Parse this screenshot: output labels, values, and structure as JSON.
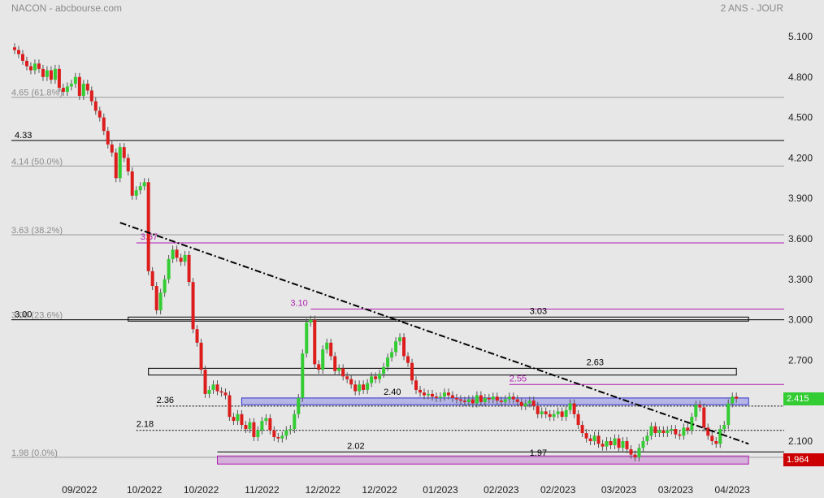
{
  "header": {
    "title": "NACON - abcbourse.com",
    "period": "2 ANS - JOUR"
  },
  "chart_data": {
    "type": "candlestick",
    "ylim": [
      1.93,
      5.16
    ],
    "y_ticks": [
      "5.100",
      "4.800",
      "4.500",
      "4.200",
      "3.900",
      "3.600",
      "3.300",
      "3.000",
      "2.700",
      "2.400",
      "2.100"
    ],
    "x_labels": [
      {
        "label": "09/2022",
        "i": 14
      },
      {
        "label": "10/2022",
        "i": 30
      },
      {
        "label": "10/2022",
        "i": 44
      },
      {
        "label": "11/2022",
        "i": 59
      },
      {
        "label": "12/2022",
        "i": 74
      },
      {
        "label": "12/2022",
        "i": 88
      },
      {
        "label": "01/2023",
        "i": 103
      },
      {
        "label": "02/2023",
        "i": 118
      },
      {
        "label": "02/2023",
        "i": 132
      },
      {
        "label": "03/2023",
        "i": 147
      },
      {
        "label": "03/2023",
        "i": 161
      },
      {
        "label": "04/2023",
        "i": 175
      }
    ],
    "colors": {
      "up": "#33cc33",
      "down": "#dd1c1c",
      "fib": "#9a9a9a",
      "magenta": "#b01eb0",
      "level": "#000000",
      "zone_blue": "#3333cc",
      "zone_mag": "#b01eb0"
    },
    "fib_levels": [
      {
        "value": 4.65,
        "label": "4.65 (61.8%)"
      },
      {
        "value": 4.14,
        "label": "4.14 (50.0%)"
      },
      {
        "value": 3.63,
        "label": "3.63 (38.2%)"
      },
      {
        "value": 3.0,
        "label": "3.00 (23.6%)"
      },
      {
        "value": 1.98,
        "label": "1.98 (0.0%)"
      }
    ],
    "hlines": [
      {
        "value": 4.33,
        "label": "4.33",
        "x_from": 0,
        "label_x": 5
      },
      {
        "value": 3.0,
        "label": "3.00",
        "x_from": 0,
        "label_x": 5
      }
    ],
    "magenta_lines": [
      {
        "value": 3.57,
        "label": "3.57",
        "i_from": 30,
        "label_i": 31
      },
      {
        "value": 3.08,
        "label": "3.10",
        "i_from": 73,
        "label_i": 68
      },
      {
        "value": 2.52,
        "label": "2.55",
        "i_from": 122,
        "label_i": 122
      }
    ],
    "rects": [
      {
        "y1": 3.02,
        "y2": 2.99,
        "i_from": 28,
        "i_to": 181,
        "label": "3.03",
        "label_i": 127,
        "label_val": 3.03,
        "style": "line"
      },
      {
        "y1": 2.64,
        "y2": 2.59,
        "i_from": 33,
        "i_to": 178,
        "label": "2.63",
        "label_i": 141,
        "label_val": 2.65,
        "style": "line"
      },
      {
        "y1": 2.42,
        "y2": 2.37,
        "i_from": 56,
        "i_to": 181,
        "label": "2.40",
        "label_i": 91,
        "label_val": 2.43,
        "style": "blue"
      },
      {
        "y1": 1.99,
        "y2": 1.93,
        "i_from": 50,
        "i_to": 181,
        "label": "1.97",
        "label_i": 127,
        "label_val": 1.98,
        "style": "mag"
      }
    ],
    "dotted_lines": [
      {
        "value": 2.36,
        "label": "2.36",
        "i_from": 35,
        "label_i": 35
      },
      {
        "value": 2.18,
        "label": "2.18",
        "i_from": 30,
        "label_i": 30
      },
      {
        "value": 2.02,
        "label": "2.02",
        "i_from": 50,
        "label_i": 82,
        "dotted": false
      }
    ],
    "trendline": {
      "i1": 26,
      "v1": 3.72,
      "i2": 181,
      "v2": 2.08
    },
    "last_price": {
      "label": "2.415",
      "value": 2.415,
      "color": "#33cc33"
    },
    "low_price": {
      "label": "1.964",
      "value": 1.964,
      "color": "#cc0000"
    },
    "closes": [
      5.0,
      4.97,
      4.92,
      4.88,
      4.85,
      4.9,
      4.86,
      4.8,
      4.85,
      4.78,
      4.86,
      4.72,
      4.69,
      4.73,
      4.75,
      4.8,
      4.66,
      4.75,
      4.7,
      4.62,
      4.55,
      4.5,
      4.4,
      4.3,
      4.24,
      4.05,
      4.28,
      4.2,
      4.1,
      3.92,
      3.96,
      3.99,
      4.02,
      3.36,
      3.25,
      3.07,
      3.2,
      3.3,
      3.45,
      3.52,
      3.46,
      3.43,
      3.48,
      3.28,
      2.93,
      2.83,
      2.63,
      2.45,
      2.48,
      2.52,
      2.47,
      2.46,
      2.44,
      2.28,
      2.25,
      2.3,
      2.22,
      2.19,
      2.24,
      2.13,
      2.18,
      2.25,
      2.27,
      2.18,
      2.13,
      2.12,
      2.14,
      2.18,
      2.19,
      2.3,
      2.42,
      2.75,
      2.98,
      3.0,
      2.67,
      2.63,
      2.78,
      2.83,
      2.73,
      2.62,
      2.64,
      2.58,
      2.56,
      2.52,
      2.47,
      2.52,
      2.48,
      2.53,
      2.58,
      2.56,
      2.6,
      2.65,
      2.72,
      2.76,
      2.84,
      2.87,
      2.73,
      2.68,
      2.55,
      2.48,
      2.46,
      2.44,
      2.45,
      2.43,
      2.42,
      2.43,
      2.46,
      2.44,
      2.42,
      2.41,
      2.4,
      2.39,
      2.41,
      2.38,
      2.44,
      2.39,
      2.42,
      2.41,
      2.43,
      2.4,
      2.39,
      2.41,
      2.43,
      2.41,
      2.39,
      2.36,
      2.38,
      2.4,
      2.36,
      2.3,
      2.32,
      2.3,
      2.28,
      2.3,
      2.32,
      2.28,
      2.33,
      2.38,
      2.3,
      2.22,
      2.16,
      2.12,
      2.1,
      2.14,
      2.08,
      2.06,
      2.1,
      2.07,
      2.12,
      2.05,
      2.1,
      2.04,
      2.0,
      1.98,
      2.05,
      2.1,
      2.14,
      2.21,
      2.16,
      2.18,
      2.16,
      2.18,
      2.19,
      2.15,
      2.14,
      2.2,
      2.18,
      2.28,
      2.37,
      2.35,
      2.2,
      2.14,
      2.1,
      2.08,
      2.19,
      2.22,
      2.38,
      2.43,
      2.415
    ]
  }
}
